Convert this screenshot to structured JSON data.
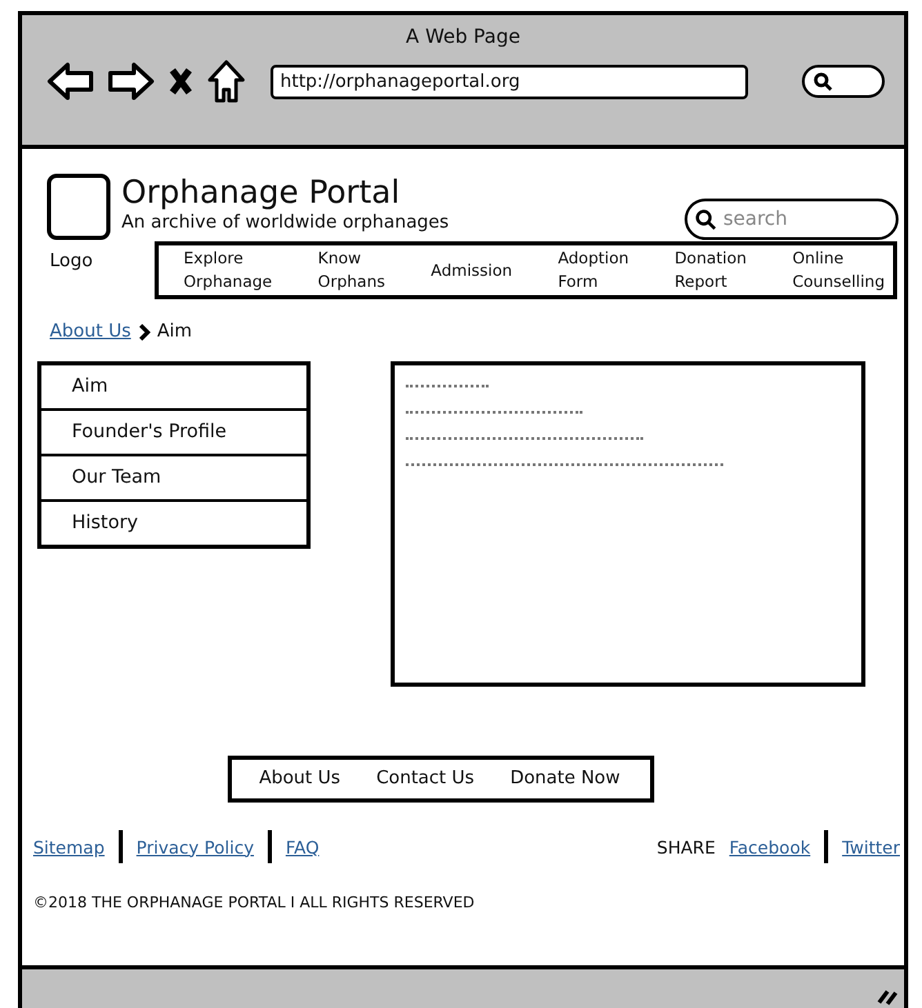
{
  "window": {
    "title": "A Web Page",
    "url": "http://orphanageportal.org"
  },
  "header": {
    "logo_label": "Logo",
    "site_title": "Orphanage Portal",
    "tagline": "An archive of worldwide orphanages",
    "search": {
      "placeholder": "search"
    }
  },
  "nav": [
    "Explore\nOrphanage",
    "Know\nOrphans",
    "Admission",
    "Adoption\nForm",
    "Donation\nReport",
    "Online\nCounselling"
  ],
  "breadcrumb": {
    "link": "About Us",
    "current": "Aim"
  },
  "side_menu": [
    "Aim",
    "Founder's Profile",
    "Our Team",
    "History"
  ],
  "footer_menu": [
    "About Us",
    "Contact Us",
    "Donate Now"
  ],
  "footer_links": [
    "Sitemap",
    "Privacy Policy",
    "FAQ"
  ],
  "share": {
    "label": "SHARE",
    "links": [
      "Facebook",
      "Twitter"
    ]
  },
  "copyright": "©2018 THE ORPHANAGE PORTAL I ALL RIGHTS RESERVED"
}
